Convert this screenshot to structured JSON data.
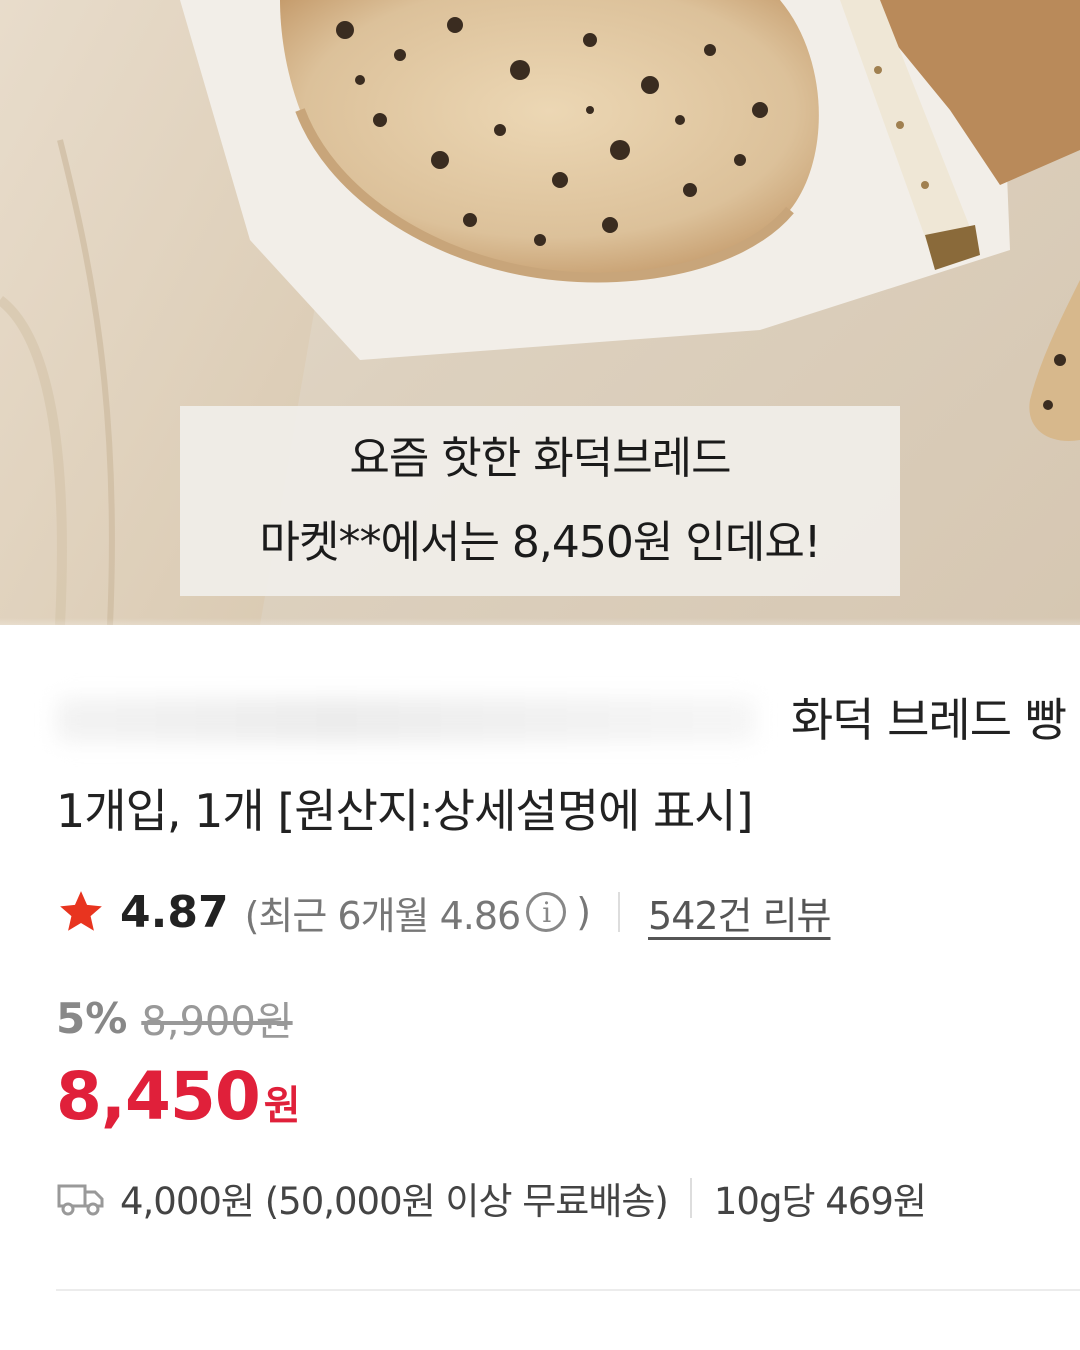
{
  "caption": {
    "line1": "요즘 핫한 화덕브레드",
    "line2": "마켓**에서는 8,450원 인데요!"
  },
  "product": {
    "title_tail": "화덕 브레드 빵",
    "title_line2": "1개입, 1개 [원산지:상세설명에 표시]"
  },
  "rating": {
    "score": "4.87",
    "recent_prefix": "(최근 6개월 4.86",
    "info_glyph": "i",
    "recent_suffix": ")",
    "review_link": "542건 리뷰",
    "star_color": "#e8341f"
  },
  "price": {
    "discount_rate": "5%",
    "original": "8,900원",
    "sale": "8,450",
    "sale_unit": "원",
    "accent_color": "#e0203a"
  },
  "shipping": {
    "icon": "truck-icon",
    "fee_text": "4,000원 (50,000원 이상 무료배송)",
    "unit_price": "10g당 469원"
  }
}
